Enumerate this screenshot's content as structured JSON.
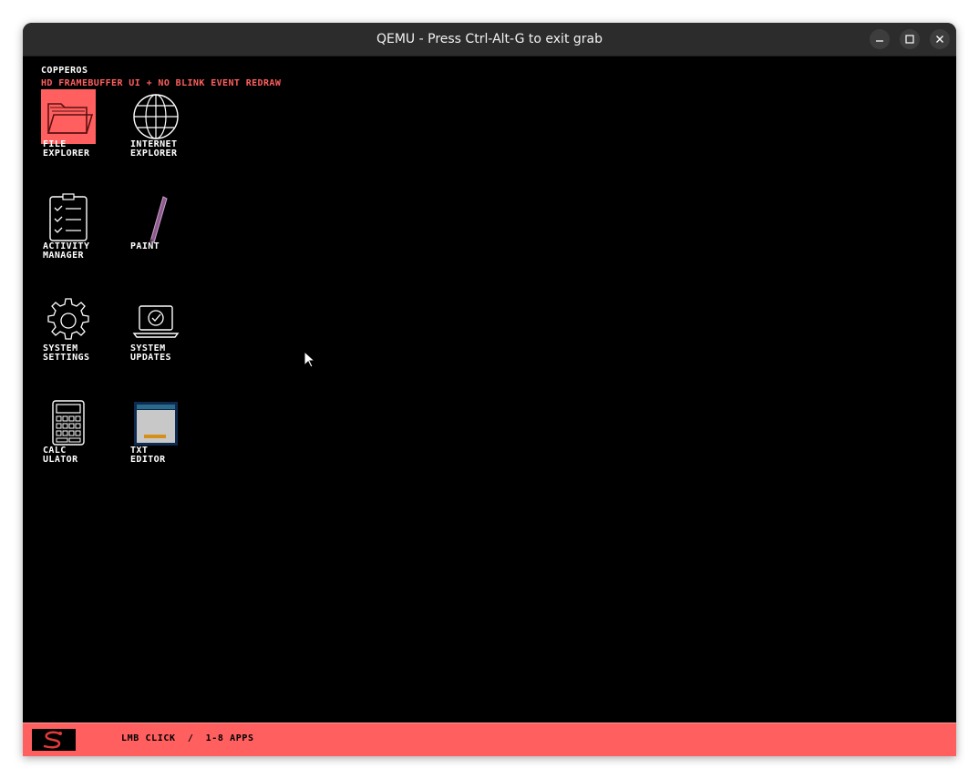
{
  "window": {
    "title": "QEMU - Press Ctrl-Alt-G to exit grab",
    "buttons": [
      "minimize-icon",
      "maximize-icon",
      "close-icon"
    ]
  },
  "desktop": {
    "os_name": "COPPEROS",
    "subtitle": "HD FRAMEBUFFER UI + NO BLINK EVENT REDRAW",
    "apps": [
      {
        "line1": "FILE",
        "line2": "EXPLORER",
        "icon": "folder-icon",
        "selected": true
      },
      {
        "line1": "INTERNET",
        "line2": "EXPLORER",
        "icon": "globe-icon",
        "selected": false
      },
      {
        "line1": "ACTIVITY",
        "line2": "MANAGER",
        "icon": "checklist-icon",
        "selected": false
      },
      {
        "line1": "PAINT",
        "line2": "",
        "icon": "pencil-icon",
        "selected": false
      },
      {
        "line1": "SYSTEM",
        "line2": "SETTINGS",
        "icon": "gear-icon",
        "selected": false
      },
      {
        "line1": "SYSTEM",
        "line2": "UPDATES",
        "icon": "laptop-update-icon",
        "selected": false
      },
      {
        "line1": "CALC",
        "line2": "ULATOR",
        "icon": "calculator-icon",
        "selected": false
      },
      {
        "line1": "TXT",
        "line2": "EDITOR",
        "icon": "text-editor-icon",
        "selected": false
      }
    ]
  },
  "taskbar": {
    "start_icon": "snake-logo-icon",
    "hint": "LMB CLICK  /  1-8 APPS"
  },
  "colors": {
    "accent": "#ff5f5f",
    "background": "#000000",
    "titlebar": "#2c2c2c"
  }
}
